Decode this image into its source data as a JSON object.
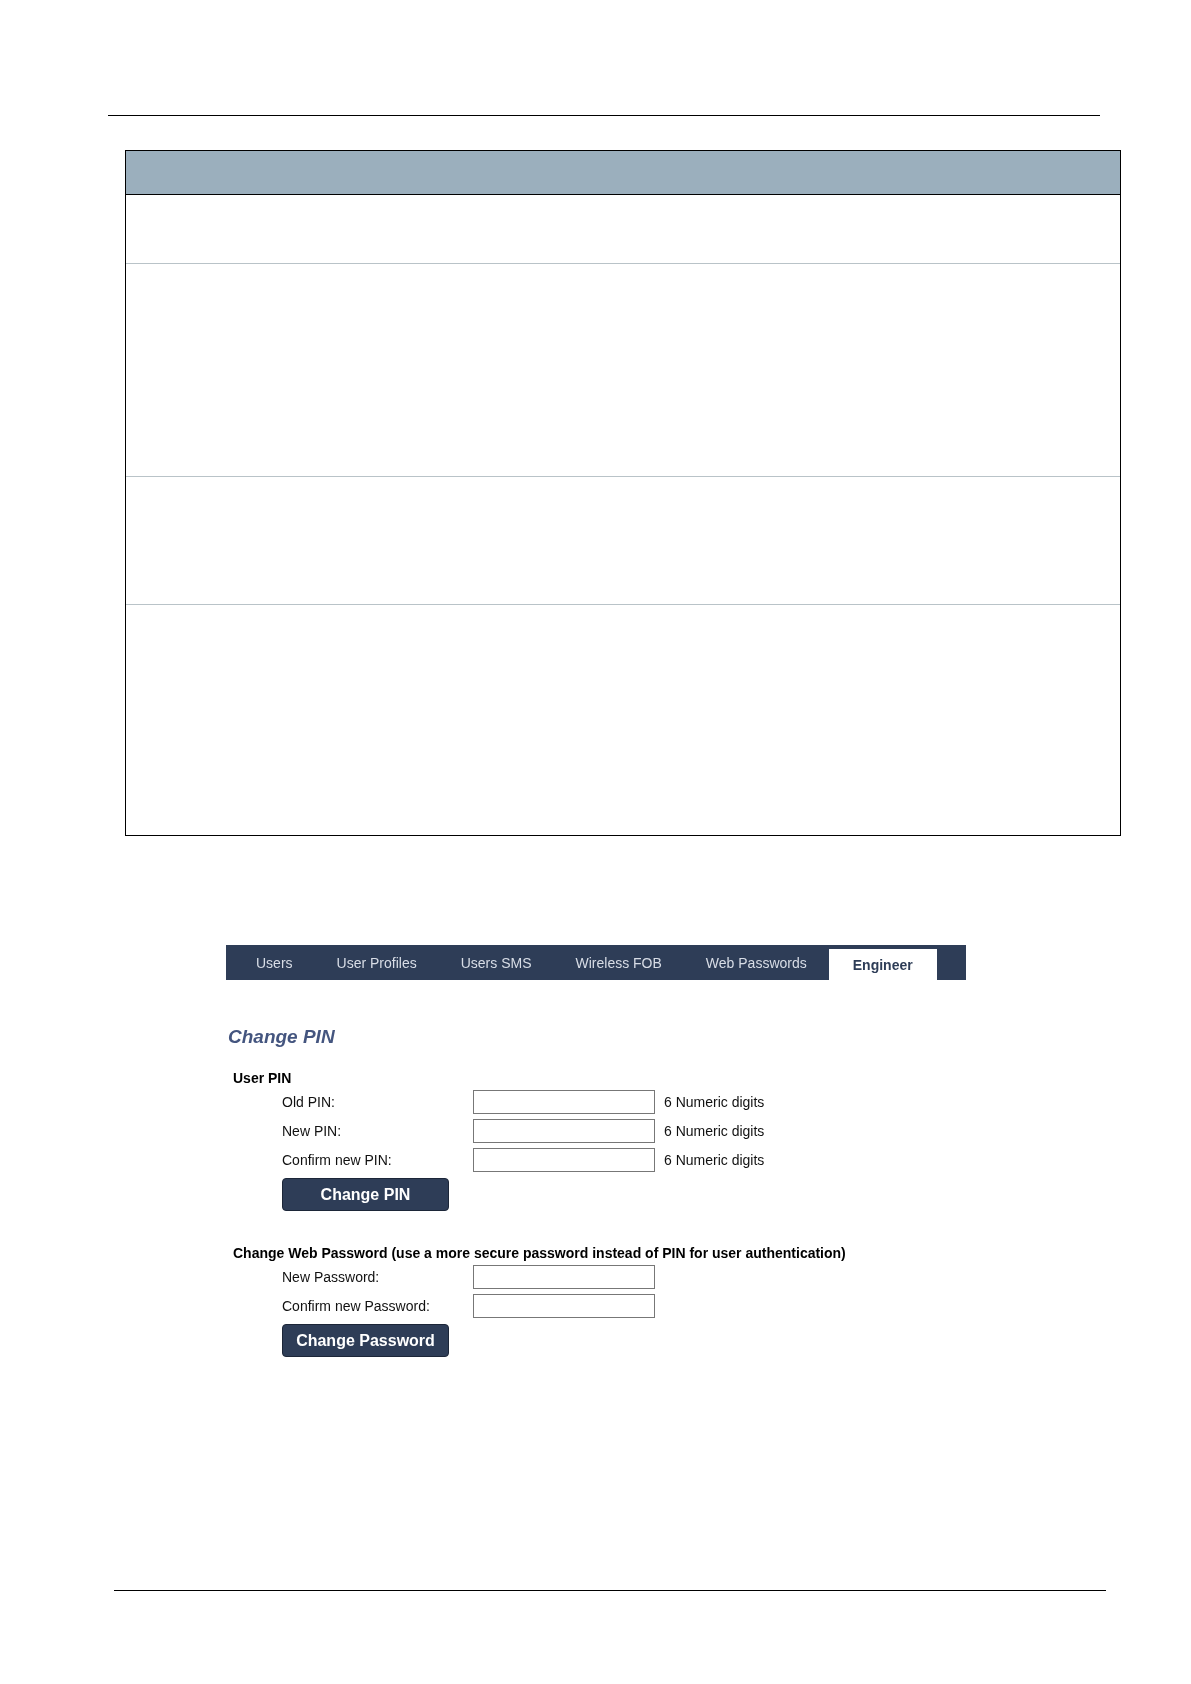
{
  "tabs": [
    {
      "label": "Users",
      "selected": false
    },
    {
      "label": "User Profiles",
      "selected": false
    },
    {
      "label": "Users SMS",
      "selected": false
    },
    {
      "label": "Wireless FOB",
      "selected": false
    },
    {
      "label": "Web Passwords",
      "selected": false
    },
    {
      "label": "Engineer",
      "selected": true
    }
  ],
  "title": "Change PIN",
  "sections": [
    {
      "heading": "User PIN",
      "fields": [
        {
          "label": "Old PIN:",
          "hint": "6 Numeric digits"
        },
        {
          "label": "New PIN:",
          "hint": "6 Numeric digits"
        },
        {
          "label": "Confirm new PIN:",
          "hint": "6 Numeric digits"
        }
      ],
      "button": "Change PIN"
    },
    {
      "heading": "Change Web Password (use a more secure password instead of PIN for user authentication)",
      "fields": [
        {
          "label": "New Password:"
        },
        {
          "label": "Confirm new Password:"
        }
      ],
      "button": "Change Password"
    }
  ]
}
